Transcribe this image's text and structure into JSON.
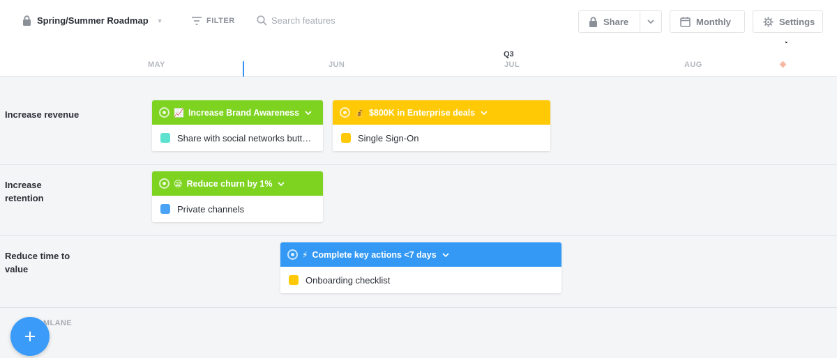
{
  "header": {
    "title": "Spring/Summer Roadmap",
    "filter_label": "FILTER",
    "search_placeholder": "Search features",
    "share_label": "Share",
    "view_label": "Monthly",
    "settings_label": "Settings"
  },
  "timeline": {
    "quarter": "Q3",
    "months": [
      "MAY",
      "JUN",
      "JUL",
      "AUG"
    ]
  },
  "lanes": [
    {
      "label": "Increase revenue",
      "goals": [
        {
          "title": "Increase Brand Awareness",
          "emoji": "📈",
          "color": "#7ed321",
          "feature": "Share with social networks butt…",
          "feature_color": "#5ce2cf"
        },
        {
          "title": "$800K in Enterprise deals",
          "emoji": "💰",
          "color": "#ffc905",
          "feature": "Single Sign-On",
          "feature_color": "#ffc905"
        }
      ]
    },
    {
      "label": "Increase retention",
      "goals": [
        {
          "title": "Reduce churn by 1%",
          "emoji": "😪",
          "color": "#7ed321",
          "feature": "Private channels",
          "feature_color": "#4aa3f5"
        }
      ]
    },
    {
      "label": "Reduce time to value",
      "goals": [
        {
          "title": "Complete key actions <7 days",
          "emoji": "⚡",
          "color": "#3399f5",
          "feature": "Onboarding checklist",
          "feature_color": "#ffc905"
        }
      ]
    }
  ],
  "footer": {
    "add_lane_label": "ADD SWIMLANE",
    "add_lane_visible": "MLANE",
    "fab_icon": "+"
  }
}
